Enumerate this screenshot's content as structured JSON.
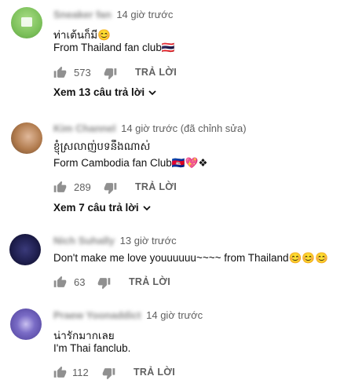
{
  "comments": [
    {
      "author": "Sneaker fan",
      "time": "14 giờ trước",
      "lines": [
        "ท่าเต้นก็มี😊",
        "From Thailand fan club🇹🇭"
      ],
      "likes": "573",
      "reply_label": "TRẢ LỜI",
      "view_replies": "Xem 13 câu trả lời",
      "avatar_color": "#7cc05a"
    },
    {
      "author": "Kim Channel",
      "time": "14 giờ trước (đã chỉnh sửa)",
      "lines": [
        "ខ្ញុំស្រលាញ់បទនឹងណាស់",
        "Form Cambodia fan Club🇰🇭💖❖"
      ],
      "likes": "289",
      "reply_label": "TRẢ LỜI",
      "view_replies": "Xem 7 câu trả lời",
      "avatar_color": "#b07a4c"
    },
    {
      "author": "Nich Suhally",
      "time": "13 giờ trước",
      "lines": [
        "Don't make me love youuuuuu~~~~ from Thailand😊😊😊"
      ],
      "likes": "63",
      "reply_label": "TRẢ LỜI",
      "avatar_color": "#1f1f4f"
    },
    {
      "author": "Praew Yoonaddict",
      "time": "14 giờ trước",
      "lines": [
        "น่ารักมากเลย",
        "I'm Thai fanclub."
      ],
      "likes": "112",
      "reply_label": "TRẢ LỜI",
      "avatar_color": "#5d4fa6"
    }
  ]
}
